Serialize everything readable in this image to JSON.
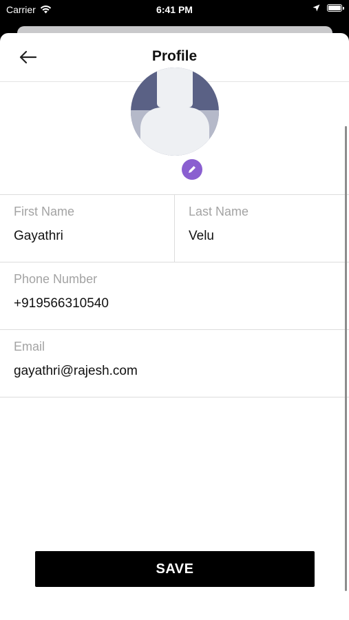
{
  "status_bar": {
    "carrier": "Carrier",
    "time": "6:41 PM"
  },
  "header": {
    "title": "Profile"
  },
  "icons": {
    "back": "arrow-left-icon",
    "edit": "pencil-icon",
    "avatar": "person-placeholder-icon"
  },
  "form": {
    "first_name": {
      "label": "First Name",
      "value": "Gayathri"
    },
    "last_name": {
      "label": "Last Name",
      "value": "Velu"
    },
    "phone": {
      "label": "Phone Number",
      "value": "+919566310540"
    },
    "email": {
      "label": "Email",
      "value": "gayathri@rajesh.com"
    }
  },
  "actions": {
    "save_label": "SAVE"
  },
  "colors": {
    "accent": "#8a5fd0",
    "button": "#000000",
    "avatar_bg": "#5a6185"
  }
}
